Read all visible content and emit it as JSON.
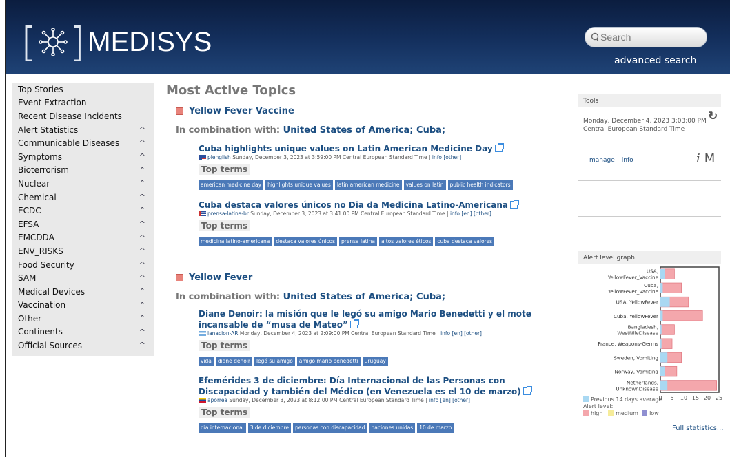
{
  "brand": "MEDISYS",
  "search": {
    "placeholder": "Search",
    "advanced_label": "advanced search"
  },
  "sidebar": {
    "items": [
      {
        "label": "Top Stories",
        "expandable": false
      },
      {
        "label": "Event Extraction",
        "expandable": false
      },
      {
        "label": "Recent Disease Incidents",
        "expandable": false
      },
      {
        "label": "Alert Statistics",
        "expandable": true
      },
      {
        "label": "Communicable Diseases",
        "expandable": true
      },
      {
        "label": "Symptoms",
        "expandable": true
      },
      {
        "label": "Bioterrorism",
        "expandable": true
      },
      {
        "label": "Nuclear",
        "expandable": true
      },
      {
        "label": "Chemical",
        "expandable": true
      },
      {
        "label": "ECDC",
        "expandable": true
      },
      {
        "label": "EFSA",
        "expandable": true
      },
      {
        "label": "EMCDDA",
        "expandable": true
      },
      {
        "label": "ENV_RISKS",
        "expandable": true
      },
      {
        "label": "Food Security",
        "expandable": true
      },
      {
        "label": "SAM",
        "expandable": true
      },
      {
        "label": "Medical Devices",
        "expandable": true
      },
      {
        "label": "Vaccination",
        "expandable": true
      },
      {
        "label": "Other",
        "expandable": true
      },
      {
        "label": "Continents",
        "expandable": true
      },
      {
        "label": "Official Sources",
        "expandable": true
      }
    ]
  },
  "main": {
    "title": "Most Active Topics",
    "combo_prefix": "In combination with:",
    "top_terms_label": "Top terms",
    "topics": [
      {
        "name": "Yellow Fever Vaccine",
        "entities": "United States of America; Cuba;",
        "articles": [
          {
            "title": "Cuba highlights unique values on Latin American Medicine Day",
            "source": "plenglish",
            "date": "Sunday, December 3, 2023 at 3:59:00 PM Central European Standard Time",
            "links": "info [other]",
            "terms": [
              "american medicine day",
              "highlights unique values",
              "latin american medicine",
              "values on latin",
              "public health indicators"
            ]
          },
          {
            "title": "Cuba destaca valores únicos no Dia da Medicina Latino-Americana",
            "source": "prensa-latina-br",
            "date": "Sunday, December 3, 2023 at 3:41:00 PM Central European Standard Time",
            "links": "info [en] [other]",
            "terms": [
              "medicina latino-americana",
              "destaca valores únicos",
              "prensa latina",
              "altos valores éticos",
              "cuba destaca valores"
            ]
          }
        ]
      },
      {
        "name": "Yellow Fever",
        "entities": "United States of America; Cuba;",
        "articles": [
          {
            "title": "Diane Denoir: la misión que le legó su amigo Mario Benedetti y el mote incansable de “musa de Mateo”",
            "source": "lanacion-AR",
            "date": "Monday, December 4, 2023 at 2:09:00 PM Central European Standard Time",
            "links": "info [en] [other]",
            "terms": [
              "vida",
              "diane denoir",
              "legó su amigo",
              "amigo mario benedetti",
              "uruguay"
            ]
          },
          {
            "title": "Efemérides 3 de diciembre: Día Internacional de las Personas con Discapacidad y también del Médico (en Venezuela es el 10 de marzo)",
            "source": "aporrea",
            "date": "Sunday, December 3, 2023 at 8:12:00 PM Central European Standard Time",
            "links": "info [en] [other]",
            "terms": [
              "día internacional",
              "3 de diciembre",
              "personas con discapacidad",
              "naciones unidas",
              "10 de marzo"
            ]
          }
        ]
      }
    ]
  },
  "tools": {
    "header": "Tools",
    "datetime": "Monday, December 4, 2023 3:03:00 PM Central European Standard Time",
    "manage_label": "manage",
    "info_label": "info"
  },
  "alert_graph": {
    "header": "Alert level graph",
    "full_stats_label": "Full statistics...",
    "legend_avg": "Previous 14 days average",
    "legend_level": "Alert level:",
    "levels": [
      "high",
      "medium",
      "low"
    ],
    "colors": {
      "high": "#f4a7ac",
      "medium": "#f6ec9a",
      "low": "#8f8fd1",
      "avg": "#a9d8f2"
    }
  },
  "chart_data": {
    "type": "bar",
    "orientation": "horizontal",
    "categories": [
      "USA, YellowFever_Vaccine",
      "Cuba, YellowFever_Vaccine",
      "USA, YellowFever",
      "Cuba, YellowFever",
      "Bangladesh, WestNileDisease",
      "France, Weapons-Germs",
      "Sweden, Vomiting",
      "Norway, Vomiting",
      "Netherlands, UnknownDisease"
    ],
    "series": [
      {
        "name": "high",
        "values": [
          6,
          9,
          12,
          18,
          6,
          5,
          9,
          7,
          24
        ]
      },
      {
        "name": "Previous 14 days average",
        "values": [
          2,
          1,
          4,
          1,
          0.5,
          0.5,
          3,
          2,
          3
        ]
      }
    ],
    "xticks": [
      0,
      5,
      10,
      15,
      20,
      25
    ],
    "xlim": [
      0,
      25
    ]
  }
}
